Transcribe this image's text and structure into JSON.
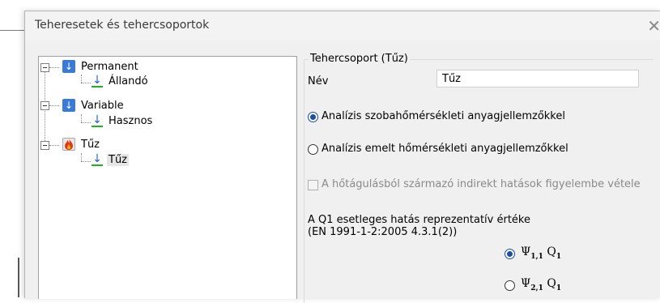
{
  "window": {
    "title": "Teheresetek és tehercsoportok"
  },
  "tree": {
    "groups": [
      {
        "label": "Permanent",
        "icon": "load-arrow-icon",
        "children": [
          {
            "label": "Állandó"
          }
        ]
      },
      {
        "label": "Variable",
        "icon": "load-arrow-icon",
        "children": [
          {
            "label": "Hasznos"
          }
        ]
      },
      {
        "label": "Tűz",
        "icon": "fire-icon",
        "children": [
          {
            "label": "Tűz",
            "selected": true
          }
        ]
      }
    ]
  },
  "group_panel": {
    "legend": "Tehercsoport (Tűz)",
    "name_label": "Név",
    "name_value": "Tűz",
    "analysis_options": [
      {
        "label": "Analízis szobahőmérsékleti anyagjellemzőkkel",
        "selected": true
      },
      {
        "label": "Analízis emelt hőmérsékleti anyagjellemzőkkel",
        "selected": false
      }
    ],
    "indirect_effects": {
      "label": "A hőtágulásból származó indirekt hatások figyelembe vétele",
      "checked": false,
      "enabled": false
    },
    "representative_value_label": "A Q1 esetleges hatás reprezentatív értéke",
    "representative_value_ref": "(EN 1991-1-2:2005 4.3.1(2))",
    "psi_options": [
      {
        "psi": "Ψ",
        "psi_sub": "1,1",
        "q": "Q",
        "q_sub": "1",
        "selected": true
      },
      {
        "psi": "Ψ",
        "psi_sub": "2,1",
        "q": "Q",
        "q_sub": "1",
        "selected": false
      }
    ]
  },
  "colors": {
    "accent": "#1b4fa0",
    "load_arrow": "#2b5fd9",
    "ground_line": "#20b020"
  }
}
